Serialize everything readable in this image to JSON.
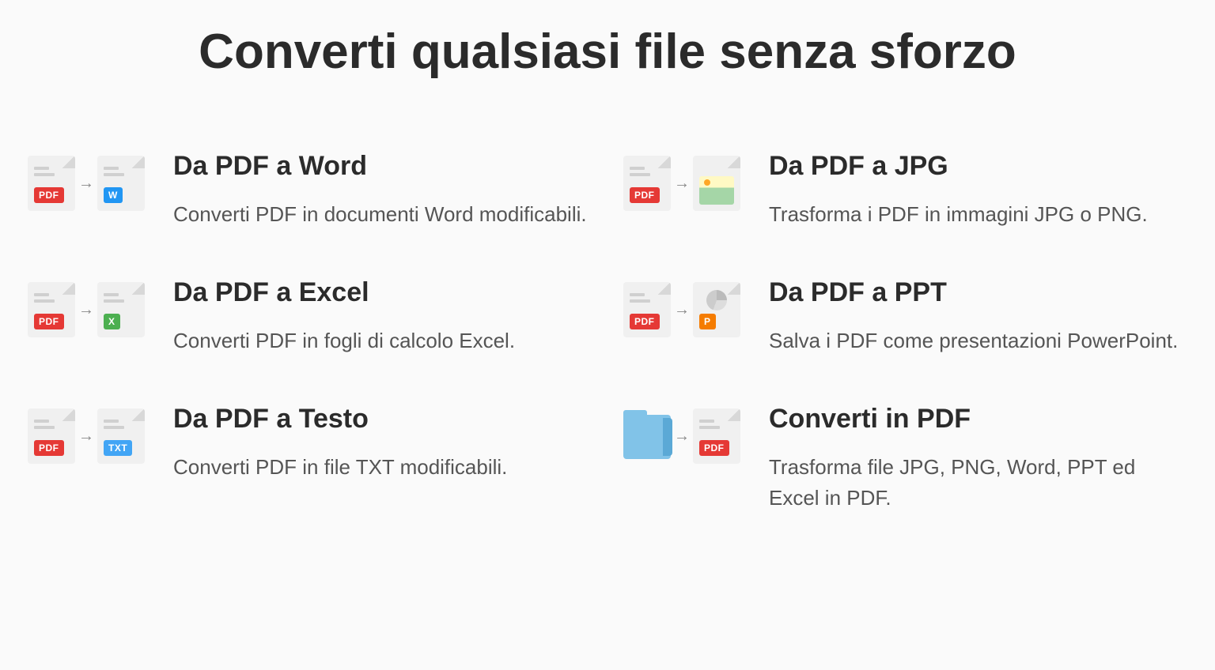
{
  "title": "Converti qualsiasi file senza sforzo",
  "tools": [
    {
      "title": "Da PDF a Word",
      "desc": "Converti PDF in documenti Word modificabili."
    },
    {
      "title": "Da PDF a JPG",
      "desc": "Trasforma i PDF in immagini JPG o PNG."
    },
    {
      "title": "Da PDF a Excel",
      "desc": "Converti PDF in fogli di calcolo Excel."
    },
    {
      "title": "Da PDF a PPT",
      "desc": "Salva i PDF come presentazioni PowerPoint."
    },
    {
      "title": "Da PDF a Testo",
      "desc": "Converti PDF in file TXT modificabili."
    },
    {
      "title": "Converti in PDF",
      "desc": "Trasforma file JPG, PNG, Word, PPT ed Excel in PDF."
    }
  ],
  "badges": {
    "pdf": "PDF",
    "w": "W",
    "x": "X",
    "txt": "TXT",
    "p": "P"
  }
}
